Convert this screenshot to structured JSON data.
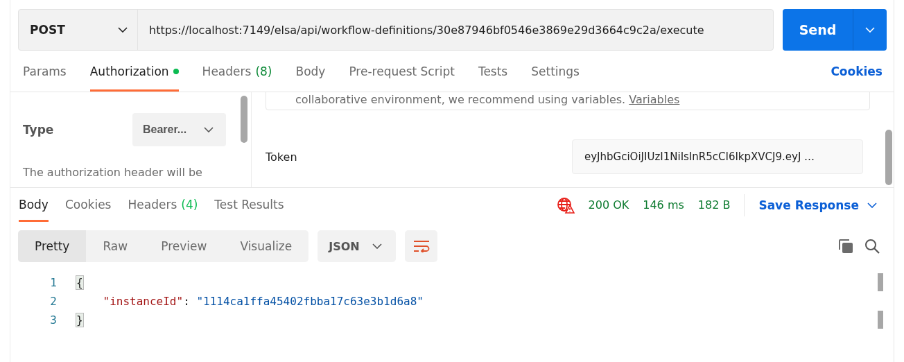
{
  "request": {
    "method": "POST",
    "url": "https://localhost:7149/elsa/api/workflow-definitions/30e87946bf0546e3869e29d3664c9c2a/execute",
    "send_label": "Send"
  },
  "request_tabs": [
    {
      "label": "Params",
      "selected": false,
      "dot": false
    },
    {
      "label": "Authorization",
      "selected": true,
      "dot": true
    },
    {
      "label": "Headers",
      "count": "(8)",
      "selected": false,
      "dot": false
    },
    {
      "label": "Body",
      "selected": false,
      "dot": false
    },
    {
      "label": "Pre-request Script",
      "selected": false,
      "dot": false
    },
    {
      "label": "Tests",
      "selected": false,
      "dot": false
    },
    {
      "label": "Settings",
      "selected": false,
      "dot": false
    }
  ],
  "cookies_link": "Cookies",
  "auth": {
    "type_label": "Type",
    "type_value": "Bearer...",
    "description": "The authorization header will be",
    "notice": "collaborative environment, we recommend using variables.",
    "notice_link": "Variables",
    "token_label": "Token",
    "token_value": "eyJhbGciOiJIUzI1NiIsInR5cCI6IkpXVCJ9.eyJ …"
  },
  "response_tabs": [
    {
      "label": "Body",
      "selected": true
    },
    {
      "label": "Cookies",
      "selected": false
    },
    {
      "label": "Headers",
      "count": "(4)",
      "selected": false
    },
    {
      "label": "Test Results",
      "selected": false
    }
  ],
  "status": {
    "code": "200 OK",
    "time": "146 ms",
    "size": "182 B",
    "save_label": "Save Response"
  },
  "view_modes": [
    {
      "label": "Pretty",
      "selected": true
    },
    {
      "label": "Raw",
      "selected": false
    },
    {
      "label": "Preview",
      "selected": false
    },
    {
      "label": "Visualize",
      "selected": false
    }
  ],
  "format": "JSON",
  "code_lines": [
    {
      "number": "1",
      "indented": false,
      "tokens": [
        {
          "kind": "brace",
          "text": "{"
        }
      ]
    },
    {
      "number": "2",
      "indented": true,
      "tokens": [
        {
          "kind": "key",
          "text": "\"instanceId\""
        },
        {
          "kind": "punct",
          "text": ": "
        },
        {
          "kind": "string",
          "text": "\"1114ca1ffa45402fbba17c63e3b1d6a8\""
        }
      ]
    },
    {
      "number": "3",
      "indented": false,
      "tokens": [
        {
          "kind": "brace",
          "text": "}"
        }
      ]
    }
  ]
}
